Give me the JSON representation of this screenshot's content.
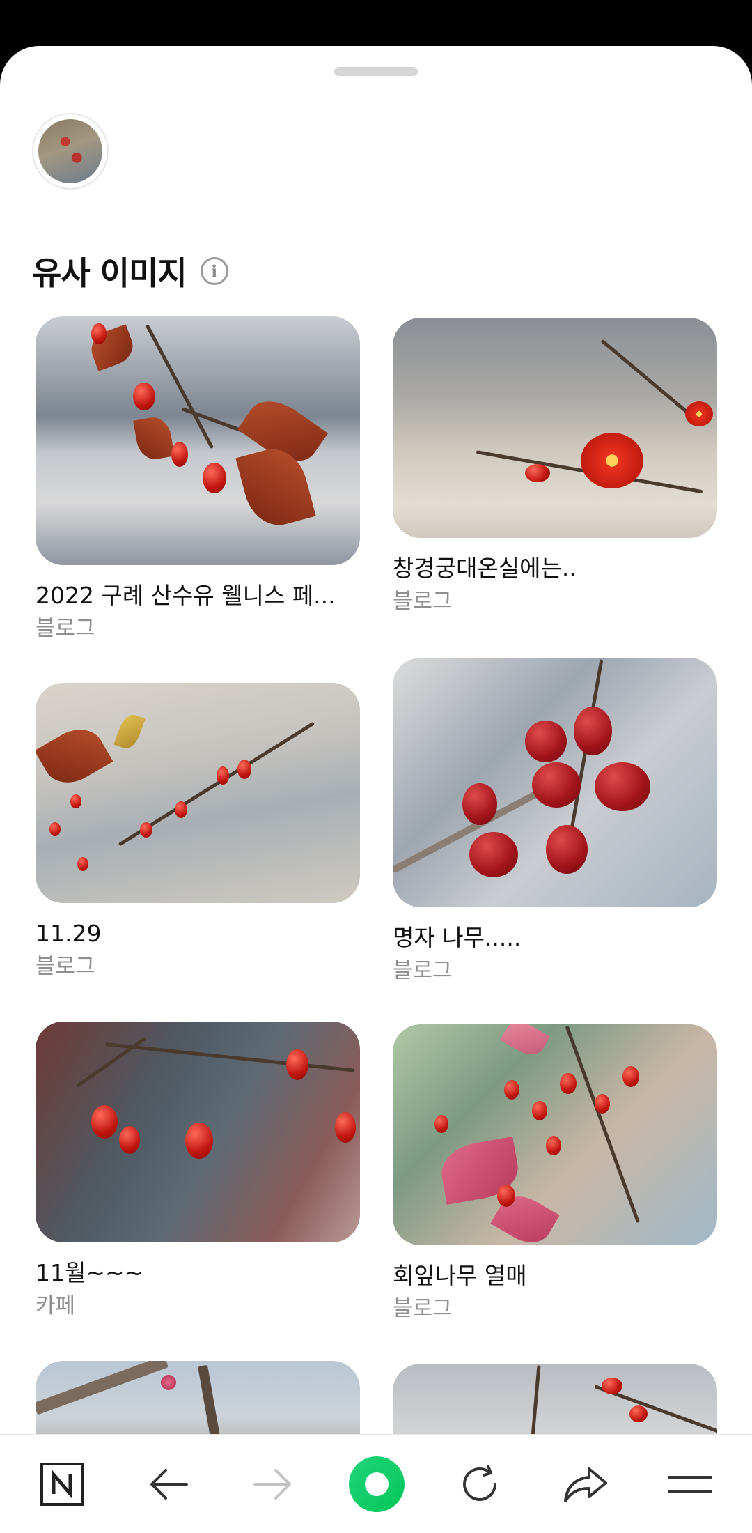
{
  "section": {
    "title": "유사 이미지",
    "info_icon": "info-icon"
  },
  "results": [
    {
      "title": "2022 구례 산수유 웰니스 페...",
      "source": "블로그"
    },
    {
      "title": "창경궁대온실에는..",
      "source": "블로그"
    },
    {
      "title": "11.29",
      "source": "블로그"
    },
    {
      "title": "명자 나무.....",
      "source": "블로그"
    },
    {
      "title": "11월~~~",
      "source": "카페"
    },
    {
      "title": "회잎나무 열매",
      "source": "블로그"
    }
  ],
  "navbar": {
    "items": [
      "naver-home-icon",
      "back-arrow-icon",
      "forward-arrow-icon",
      "green-dot-button",
      "reload-icon",
      "share-icon",
      "menu-icon"
    ],
    "accent": "#03c75a"
  }
}
